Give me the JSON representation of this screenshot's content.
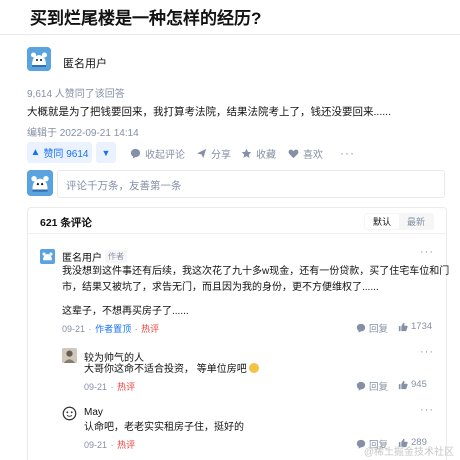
{
  "question": {
    "title": "买到烂尾楼是一种怎样的经历?"
  },
  "answer": {
    "author": "匿名用户",
    "upvote_meta": "9,614 人赞同了该回答",
    "text": "大概就是为了把钱要回来，我打算考法院，结果法院考上了，钱还没要回来......",
    "edit_time": "编辑于 2022-09-21 14:14",
    "vote_label": "赞同 9614",
    "actions": {
      "comments": "收起评论",
      "share": "分享",
      "favorite": "收藏",
      "like": "喜欢"
    }
  },
  "comment_input": {
    "placeholder": "评论千万条，友善第一条"
  },
  "comments": {
    "count_label": "621 条评论",
    "sort": {
      "default": "默认",
      "latest": "最新"
    },
    "items": [
      {
        "name": "匿名用户",
        "badge": "作者",
        "lines": [
          "我没想到这件事还有后续，我这次花了九十多w现金，还有一份贷款，买了住宅车位和门",
          "市，结果又被坑了，求告无门，而且因为我的身份，更不方便维权了......",
          "",
          "这辈子，不想再买房子了......"
        ],
        "date": "09-21",
        "tag1": "作者置顶",
        "tag2": "热评",
        "reply": "回复",
        "likes": "1734"
      },
      {
        "name": "较为帅气的人",
        "text": "大哥你这命不适合投资，   等单位房吧",
        "date": "09-21",
        "tag2": "热评",
        "reply": "回复",
        "likes": "945"
      },
      {
        "name": "May",
        "text": "认命吧，老老实实租房子住，挺好的",
        "date": "09-21",
        "tag2": "热评",
        "reply": "回复",
        "likes": "289"
      }
    ]
  },
  "watermark": "@稀土掘金技术社区",
  "colors": {
    "accent": "#1772f6",
    "meta": "#8590a6",
    "hot": "#f1403c",
    "avatar_bg": "#5aa3de"
  }
}
